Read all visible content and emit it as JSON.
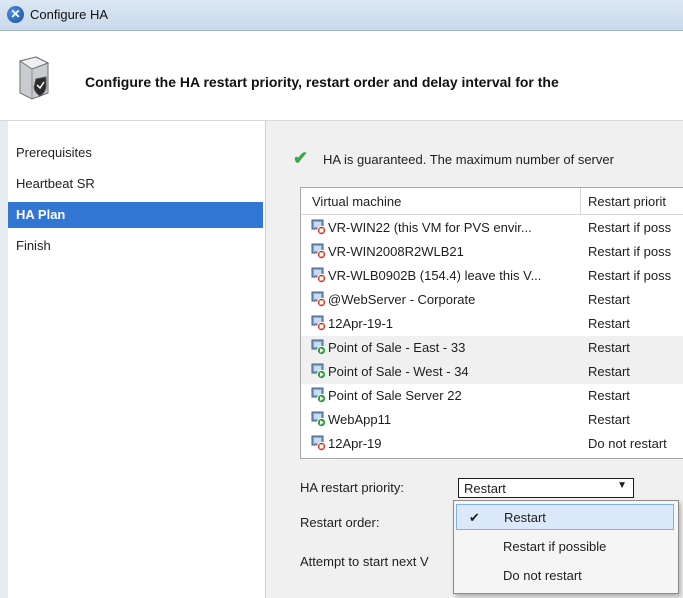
{
  "window": {
    "title": "Configure HA"
  },
  "header": {
    "heading": "Configure the HA restart priority, restart order and delay interval for the"
  },
  "sidebar": {
    "items": [
      {
        "label": "Prerequisites",
        "active": false
      },
      {
        "label": "Heartbeat SR",
        "active": false
      },
      {
        "label": "HA Plan",
        "active": true
      },
      {
        "label": "Finish",
        "active": false
      }
    ]
  },
  "status": {
    "text": "HA is guaranteed. The maximum number of server"
  },
  "grid": {
    "columns": [
      "Virtual machine",
      "Restart priorit"
    ],
    "rows": [
      {
        "name": "VR-WIN22 (this VM for PVS envir...",
        "priority": "Restart if poss",
        "state": "stopped"
      },
      {
        "name": "VR-WIN2008R2WLB21",
        "priority": "Restart if poss",
        "state": "stopped"
      },
      {
        "name": "VR-WLB0902B (154.4) leave this V...",
        "priority": "Restart if poss",
        "state": "stopped"
      },
      {
        "name": "@WebServer - Corporate",
        "priority": "Restart",
        "state": "stopped"
      },
      {
        "name": "12Apr-19-1",
        "priority": "Restart",
        "state": "stopped"
      },
      {
        "name": "Point of Sale - East - 33",
        "priority": "Restart",
        "state": "running"
      },
      {
        "name": "Point of Sale - West - 34",
        "priority": "Restart",
        "state": "running"
      },
      {
        "name": "Point of Sale Server 22",
        "priority": "Restart",
        "state": "running"
      },
      {
        "name": "WebApp11",
        "priority": "Restart",
        "state": "running"
      },
      {
        "name": "12Apr-19",
        "priority": "Do not restart",
        "state": "stopped"
      }
    ]
  },
  "form": {
    "priority_label": "HA restart priority:",
    "priority_value": "Restart",
    "order_label": "Restart order:",
    "attempt_label": "Attempt to start next V"
  },
  "dropdown": {
    "options": [
      {
        "label": "Restart",
        "selected": true
      },
      {
        "label": "Restart if possible",
        "selected": false
      },
      {
        "label": "Do not restart",
        "selected": false
      }
    ]
  },
  "colors": {
    "accent": "#3276d3",
    "running": "#2fa33a",
    "stopped": "#d43a1e"
  }
}
